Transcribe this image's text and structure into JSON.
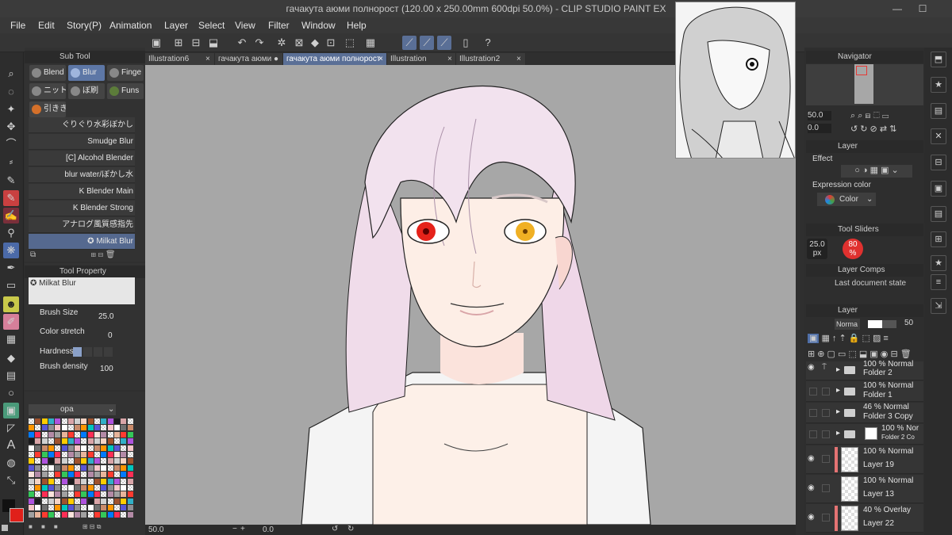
{
  "window": {
    "title": "гачакута аюми полнорост (120.00 x 250.00mm 600dpi 50.0%)  - CLIP STUDIO PAINT EX",
    "minimize": "—",
    "maximize": "☐"
  },
  "menu": [
    "File",
    "Edit",
    "Story(P)",
    "Animation",
    "Layer",
    "Select",
    "View",
    "Filter",
    "Window",
    "Help"
  ],
  "tabs": [
    {
      "label": "Illustration6",
      "close": "×"
    },
    {
      "label": "гачакута аюми",
      "close": "×"
    },
    {
      "label": "гачакута аюми полнорост",
      "close": "×"
    },
    {
      "label": "Illustration",
      "close": "×"
    },
    {
      "label": "Illustration2",
      "close": "×"
    }
  ],
  "subtool": {
    "header": "Sub Tool",
    "groups": [
      "Blend",
      "Blur",
      "Finge",
      "ニット",
      "ぼ刷",
      "Funs",
      "引きき"
    ],
    "brushes": [
      "ぐりぐり水彩ぼかし",
      "Smudge Blur",
      "[C] Alcohol Blender",
      "blur water/ぼかし水",
      "K Blender Main",
      "K Blender Strong",
      "アナログ風質感指先",
      "✪ Milkat Blur"
    ]
  },
  "tool_property": {
    "header": "Tool Property",
    "preset": "✪ Milkat Blur",
    "brush_size_label": "Brush Size",
    "brush_size_value": "25.0",
    "color_stretch_label": "Color stretch",
    "color_stretch_value": "0",
    "hardness_label": "Hardness",
    "brush_density_label": "Brush density",
    "brush_density_value": "100"
  },
  "palette": {
    "set_name": "opa"
  },
  "statusbar": {
    "zoom": "50.0",
    "rotation": "0.0"
  },
  "navigator": {
    "header": "Navigator",
    "zoom": "50.0",
    "angle": "0.0"
  },
  "layer_property": {
    "header": "Layer",
    "effect_label": "Effect",
    "expression_label": "Expression color",
    "expression_value": "Color"
  },
  "tool_sliders": {
    "header": "Tool Sliders",
    "size_value": "25.0",
    "size_unit": "px",
    "opacity_value": "80",
    "opacity_unit": "%"
  },
  "layer_comps": {
    "header": "Layer Comps",
    "item": "Last document state"
  },
  "layers": {
    "header": "Layer",
    "blend_mode": "Norma",
    "opacity": "50",
    "items": [
      {
        "line1": "100 % Normal",
        "line2": "Folder 2",
        "kind": "folder"
      },
      {
        "line1": "100 % Normal",
        "line2": "Folder 1",
        "kind": "folder"
      },
      {
        "line1": "46 % Normal",
        "line2": "Folder 3 Copy",
        "kind": "folder"
      },
      {
        "line1": "100 % Nor",
        "line2": "Folder 2 Co",
        "kind": "folder-mask"
      },
      {
        "line1": "100 % Normal",
        "line2": "Layer 19",
        "kind": "raster"
      },
      {
        "line1": "100 % Normal",
        "line2": "Layer 13",
        "kind": "raster"
      },
      {
        "line1": "40 % Overlay",
        "line2": "Layer 22",
        "kind": "raster"
      }
    ]
  },
  "colors": {
    "accent": "#5a6f96",
    "slider_red": "#e0312f",
    "main_color": "#111111",
    "sub_color": "#e0201a"
  },
  "icons": {
    "close": "×",
    "open_arrow": "▸"
  }
}
